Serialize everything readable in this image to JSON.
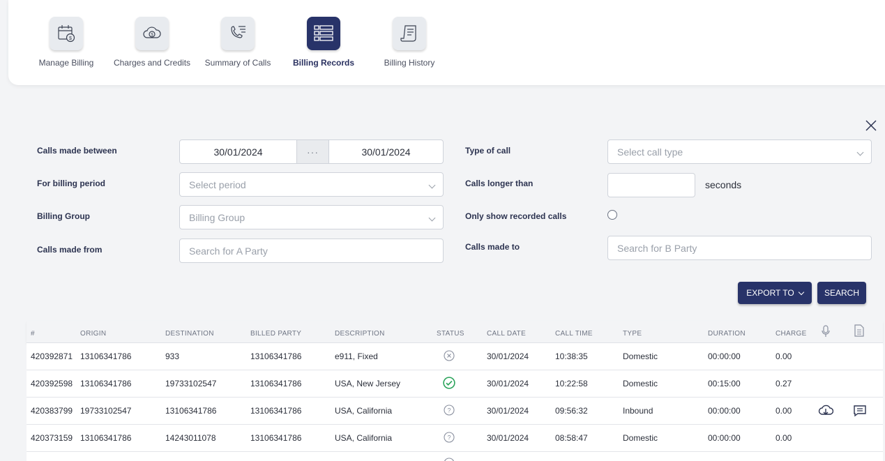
{
  "nav": {
    "items": [
      {
        "label": "Manage Billing",
        "icon": "calendar-dollar-icon",
        "active": false
      },
      {
        "label": "Charges and Credits",
        "icon": "cloud-dollar-icon",
        "active": false
      },
      {
        "label": "Summary of Calls",
        "icon": "phone-list-icon",
        "active": false
      },
      {
        "label": "Billing Records",
        "icon": "list-records-icon",
        "active": true
      },
      {
        "label": "Billing History",
        "icon": "receipt-scroll-icon",
        "active": false
      }
    ]
  },
  "filters": {
    "calls_made_between_label": "Calls made between",
    "date_from": "30/01/2024",
    "date_sep": "···",
    "date_to": "30/01/2024",
    "billing_period_label": "For billing period",
    "billing_period_placeholder": "Select period",
    "billing_group_label": "Billing Group",
    "billing_group_placeholder": "Billing Group",
    "calls_from_label": "Calls made from",
    "calls_from_placeholder": "Search for A Party",
    "type_of_call_label": "Type of call",
    "type_of_call_placeholder": "Select call type",
    "longer_than_label": "Calls longer than",
    "longer_than_value": "",
    "seconds_label": "seconds",
    "recorded_label": "Only show recorded calls",
    "calls_to_label": "Calls made to",
    "calls_to_placeholder": "Search for B Party"
  },
  "actions": {
    "export_label": "EXPORT TO",
    "search_label": "SEARCH"
  },
  "table": {
    "headers": {
      "num": "#",
      "origin": "ORIGIN",
      "destination": "DESTINATION",
      "billed_party": "BILLED PARTY",
      "description": "DESCRIPTION",
      "status": "STATUS",
      "call_date": "CALL DATE",
      "call_time": "CALL TIME",
      "type": "TYPE",
      "duration": "DURATION",
      "charge": "CHARGE"
    },
    "rows": [
      {
        "num": "420392871",
        "origin": "13106341786",
        "destination": "933",
        "billed_party": "13106341786",
        "description": "e911, Fixed",
        "status": "failed",
        "call_date": "30/01/2024",
        "call_time": "10:38:35",
        "type": "Domestic",
        "duration": "00:00:00",
        "charge": "0.00",
        "recording": false
      },
      {
        "num": "420392598",
        "origin": "13106341786",
        "destination": "19733102547",
        "billed_party": "13106341786",
        "description": "USA, New Jersey",
        "status": "success",
        "call_date": "30/01/2024",
        "call_time": "10:22:58",
        "type": "Domestic",
        "duration": "00:15:00",
        "charge": "0.27",
        "recording": false
      },
      {
        "num": "420383799",
        "origin": "19733102547",
        "destination": "13106341786",
        "billed_party": "13106341786",
        "description": "USA, California",
        "status": "unknown",
        "call_date": "30/01/2024",
        "call_time": "09:56:32",
        "type": "Inbound",
        "duration": "00:00:00",
        "charge": "0.00",
        "recording": true
      },
      {
        "num": "420373159",
        "origin": "13106341786",
        "destination": "14243011078",
        "billed_party": "13106341786",
        "description": "USA, California",
        "status": "unknown",
        "call_date": "30/01/2024",
        "call_time": "08:58:47",
        "type": "Domestic",
        "duration": "00:00:00",
        "charge": "0.00",
        "recording": false
      }
    ]
  },
  "colors": {
    "primary": "#283369",
    "success": "#2aa35a",
    "muted_icon": "#8b91a0"
  }
}
